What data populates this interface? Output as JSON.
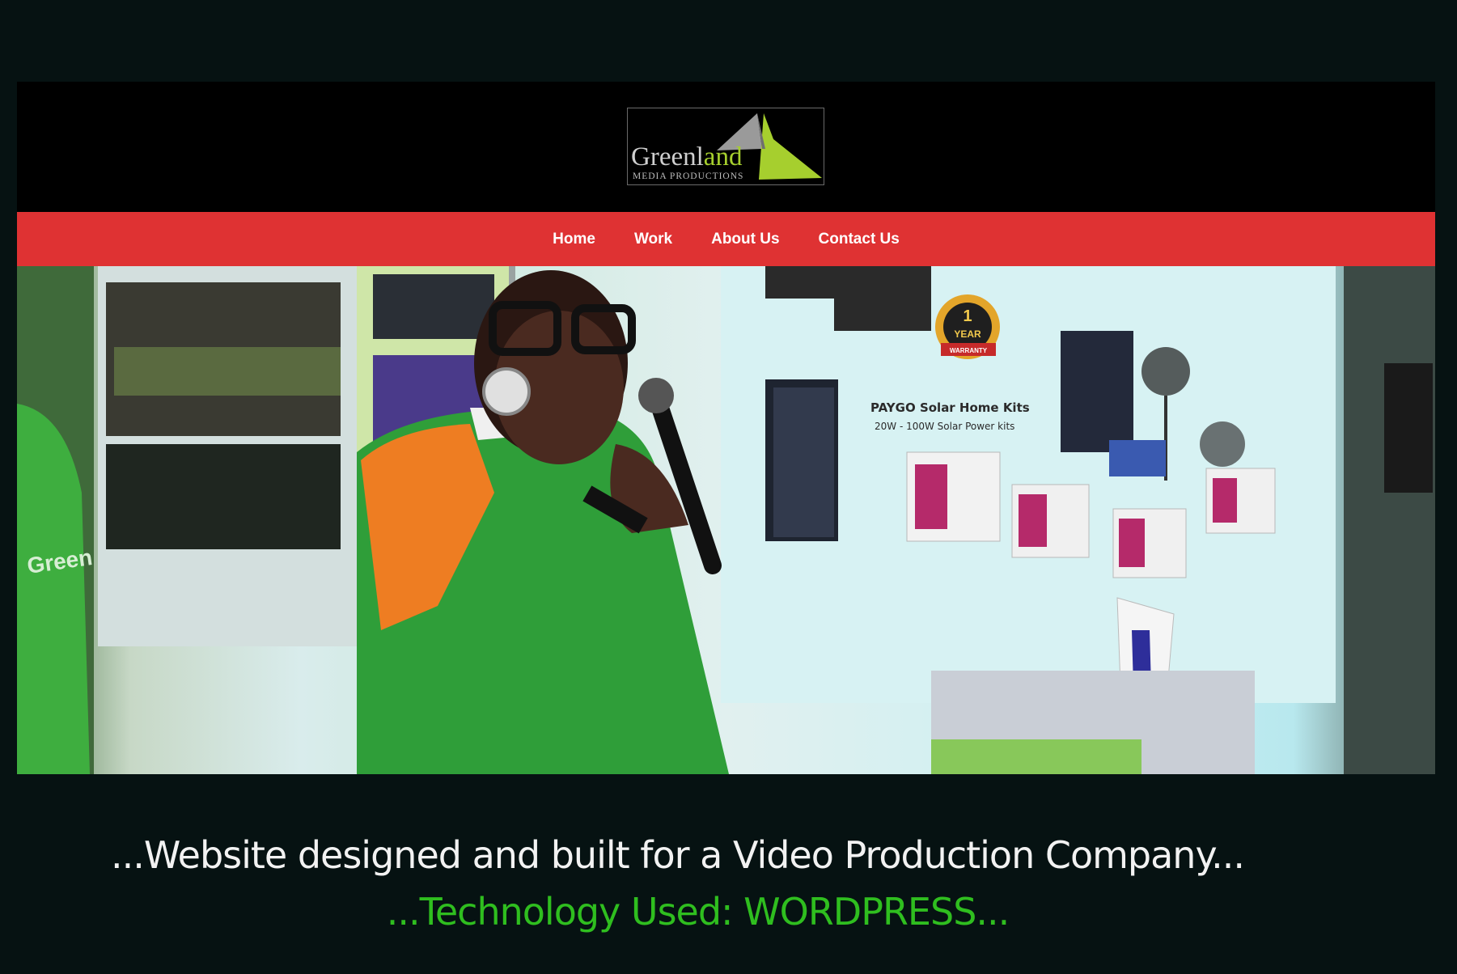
{
  "logo": {
    "word_plain": "Greenl",
    "word_accent": "and",
    "subtitle": "MEDIA PRODUCTIONS"
  },
  "nav": {
    "items": [
      {
        "label": "Home"
      },
      {
        "label": "Work"
      },
      {
        "label": "About Us"
      },
      {
        "label": "Contact Us"
      }
    ]
  },
  "hero": {
    "poster_title": "PAYGO Solar Home Kits",
    "poster_subtitle": "20W - 100W Solar Power kits",
    "badge_top": "1",
    "badge_mid": "YEAR",
    "badge_bottom": "WARRANTY",
    "shirt_text": "Green"
  },
  "captions": {
    "line1": "...Website designed and built for a Video Production Company...",
    "line2": "...Technology Used: WORDPRESS..."
  },
  "colors": {
    "background": "#061212",
    "nav_bar": "#df3233",
    "accent_green": "#2fbe1f",
    "logo_green": "#a6cf2e"
  }
}
